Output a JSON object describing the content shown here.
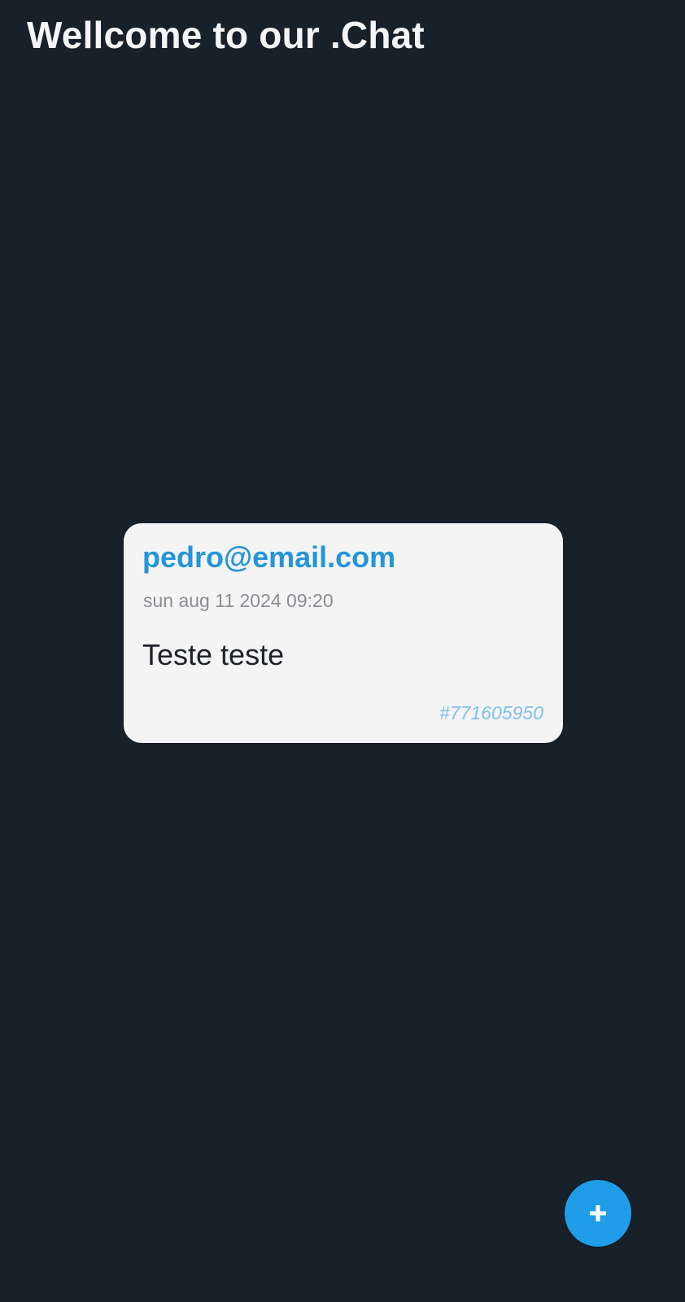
{
  "header": {
    "title": "Wellcome to our .Chat"
  },
  "message": {
    "sender": "pedro@email.com",
    "timestamp": "sun aug 11 2024 09:20",
    "text": "Teste teste",
    "id": "#771605950"
  },
  "actions": {
    "add_icon": "plus-icon",
    "fab_color": "#1f9de8"
  },
  "colors": {
    "background": "#18202a",
    "card": "#f4f4f5",
    "accent": "#2495d9",
    "message_id": "#7fc0e8"
  }
}
